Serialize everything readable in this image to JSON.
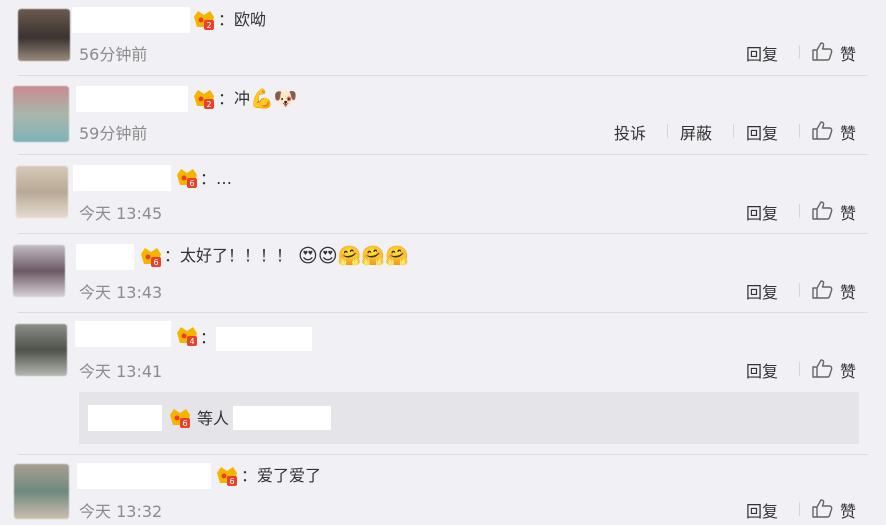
{
  "comments": [
    {
      "text": "：欧呦",
      "time": "56分钟前",
      "actions": [
        "回复",
        "赞"
      ],
      "avatar_colors": [
        "#6b5a4e",
        "#3a3330",
        "#9a8a7d"
      ]
    },
    {
      "text": "：冲",
      "emojis": [
        "💪",
        "🐶"
      ],
      "time": "59分钟前",
      "actions": [
        "投诉",
        "屏蔽",
        "回复",
        "赞"
      ],
      "avatar_colors": [
        "#c98a8f",
        "#a9b7ac",
        "#7fb3b7"
      ]
    },
    {
      "text": "：…",
      "time": "今天 13:45",
      "actions": [
        "回复",
        "赞"
      ],
      "avatar_colors": [
        "#d7c9b7",
        "#b8a995",
        "#e6dccf"
      ]
    },
    {
      "text": "：太好了！！！！",
      "emojis": [
        "😍",
        "😍",
        "🤗",
        "🤗",
        "🤗"
      ],
      "time": "今天 13:43",
      "actions": [
        "回复",
        "赞"
      ],
      "avatar_colors": [
        "#c4bcc4",
        "#6b5865",
        "#d9d2d6"
      ]
    },
    {
      "text": "：",
      "time": "今天 13:41",
      "actions": [
        "回复",
        "赞"
      ],
      "avatar_colors": [
        "#8b8f86",
        "#4f524c",
        "#b5b8b0"
      ]
    },
    {
      "text": "：爱了爱了",
      "time": "今天 13:32",
      "actions": [
        "回复",
        "赞"
      ],
      "avatar_colors": [
        "#a99f93",
        "#6d8a7e",
        "#cdbfae"
      ]
    }
  ],
  "reply": {
    "text": "等人"
  },
  "colors": {
    "background": "#f0f0f5",
    "meta_gray": "#8c8c8c",
    "reply_bg": "#e4e4e9",
    "badge_red": "#e8412c",
    "badge_gold": "#f5b400"
  },
  "icons": [
    "vip-badge-icon",
    "like-thumb-icon"
  ]
}
